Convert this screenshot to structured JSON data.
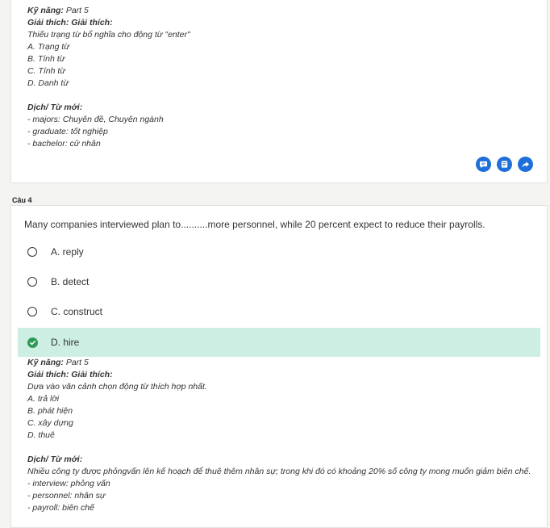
{
  "previous_explanation": {
    "skill_label": "Kỹ năng:",
    "skill_value": " Part 5",
    "explain_label": "Giải thích: Giải thích:",
    "lines": [
      "Thiếu trạng từ bổ nghĩa cho động từ \"enter\"",
      "A. Trạng từ",
      "B. Tính từ",
      "C. Tính từ",
      "D. Danh từ"
    ],
    "vocab_label": "Dịch/ Từ mới:",
    "vocab": [
      "- majors: Chuyên đề, Chuyên ngành",
      "- graduate: tốt nghiệp",
      "- bachelor: cử nhân"
    ]
  },
  "action_icons": [
    "comment-icon",
    "note-icon",
    "share-icon"
  ],
  "question": {
    "label": "Câu 4",
    "text": "Many companies interviewed plan to..........more personnel, while 20 percent expect to reduce their payrolls.",
    "options": [
      {
        "label": "A. reply",
        "selected": false
      },
      {
        "label": "B. detect",
        "selected": false
      },
      {
        "label": "C. construct",
        "selected": false
      },
      {
        "label": "D. hire",
        "selected": true
      }
    ]
  },
  "explanation": {
    "skill_label": "Kỹ năng:",
    "skill_value": " Part 5",
    "explain_label": "Giải thích: Giải thích:",
    "lines": [
      "Dựa vào văn cảnh chọn động từ thích hợp nhất.",
      "A. trả lời",
      "B. phát hiện",
      "C. xây dựng",
      "D. thuê"
    ],
    "vocab_label": "Dịch/ Từ mới:",
    "vocab": [
      "Nhiều công ty được phỏngvấn lên kế hoạch để thuê thêm nhân sự; trong khi đó có khoảng 20% số công ty mong muốn giảm biên chế.",
      "- interview: phỏng vấn",
      "- personnel: nhân sự",
      "- payroll: biên chế"
    ]
  },
  "colors": {
    "accent": "#1e6fd9",
    "correct_bg": "#cdeee2",
    "correct_check": "#2e9a5a"
  }
}
